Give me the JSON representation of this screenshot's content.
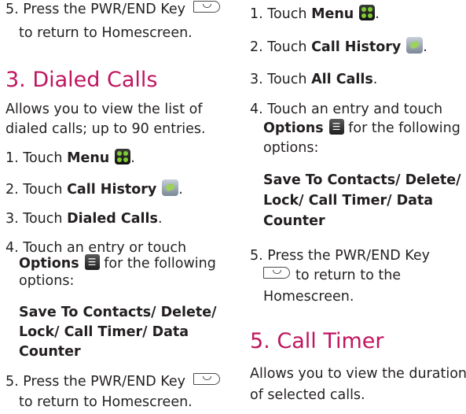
{
  "left": {
    "step5_a": "5. Press the PWR/END Key",
    "step5_b": "to return to Homescreen.",
    "heading": "3. Dialed Calls",
    "desc_line1": "Allows you to view the list of",
    "desc_line2": "dialed calls; up to 90 entries.",
    "step1_prefix": "1. Touch ",
    "step1_bold": "Menu",
    "step1_suffix": ".",
    "step2_prefix": "2. Touch ",
    "step2_bold": "Call History",
    "step2_suffix": ".",
    "step3_prefix": "3. Touch ",
    "step3_bold": "Dialed Calls",
    "step3_suffix": ".",
    "step4_line1": "4. Touch an entry or touch",
    "step4_bold": "Options",
    "step4_line2_rest": " for the following",
    "step4_line3": "options:",
    "options_line1": "Save To Contacts/ Delete/",
    "options_line2": "Lock/ Call Timer/ Data",
    "options_line3": "Counter",
    "step5b_a": "5. Press the PWR/END Key",
    "step5b_b": "to return to Homescreen."
  },
  "right": {
    "step1_prefix": "1. Touch ",
    "step1_bold": "Menu",
    "step1_suffix": ".",
    "step2_prefix": "2. Touch ",
    "step2_bold": "Call History",
    "step2_suffix": ".",
    "step3_prefix": "3. Touch ",
    "step3_bold": "All Calls",
    "step3_suffix": ".",
    "step4_line1": "4. Touch an entry and touch",
    "step4_bold": "Options",
    "step4_line2_rest": " for the following",
    "step4_line3": "options:",
    "options_line1": "Save To Contacts/ Delete/",
    "options_line2": "Lock/ Call Timer/ Data",
    "options_line3": "Counter",
    "step5_a": "5. Press the PWR/END Key",
    "step5_b": "to return to the",
    "step5_c": "Homescreen.",
    "heading": "5. Call Timer",
    "desc_line1": "Allows you to view the duration",
    "desc_line2": "of selected calls."
  },
  "icons": {
    "menu": "menu-grid-icon",
    "call_history": "call-history-icon",
    "options": "options-icon",
    "end_key": "power-end-key-icon"
  },
  "colors": {
    "heading": "#c0155f",
    "text": "#231f20",
    "menu_dots": "#7fcc35"
  }
}
